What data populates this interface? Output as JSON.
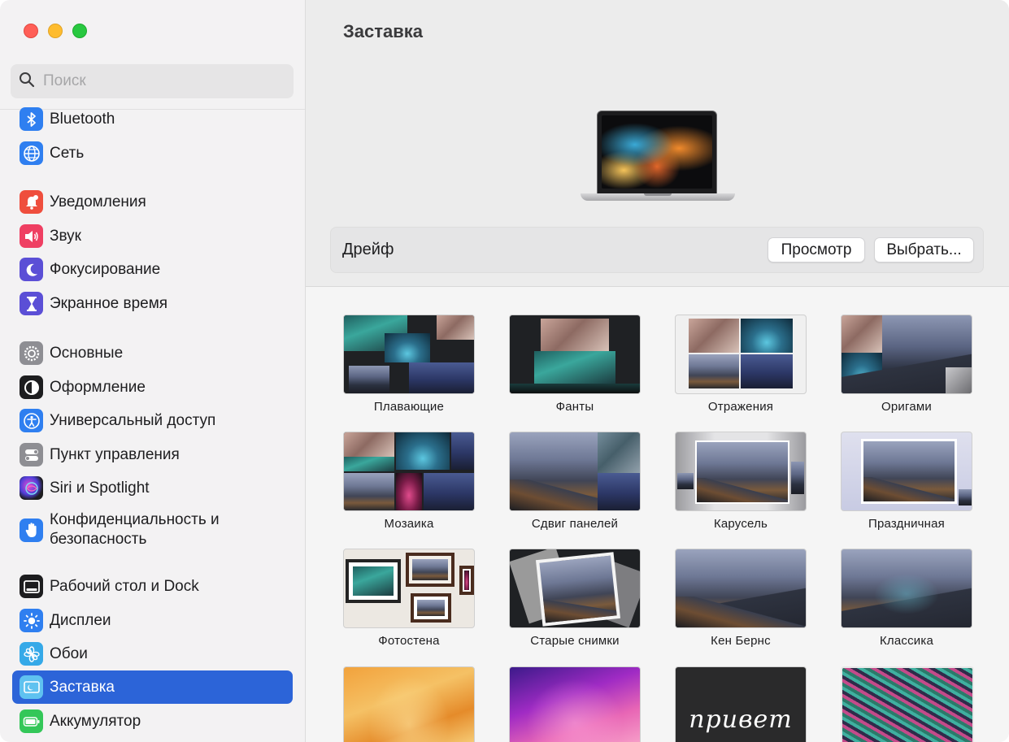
{
  "window": {
    "title": "Заставка"
  },
  "search": {
    "placeholder": "Поиск"
  },
  "sidebar": {
    "items": [
      {
        "label": "Bluetooth",
        "icon": "bluetooth-icon",
        "color": "#2f7ff0"
      },
      {
        "label": "Сеть",
        "icon": "globe-icon",
        "color": "#2f7ff0"
      },
      {
        "label": "Уведомления",
        "icon": "bell-icon",
        "color": "#ef4e3d"
      },
      {
        "label": "Звук",
        "icon": "speaker-icon",
        "color": "#ef3f62"
      },
      {
        "label": "Фокусирование",
        "icon": "moon-icon",
        "color": "#5b4fd6"
      },
      {
        "label": "Экранное время",
        "icon": "hourglass-icon",
        "color": "#5b4fd6"
      },
      {
        "label": "Основные",
        "icon": "gear-icon",
        "color": "#8e8e93"
      },
      {
        "label": "Оформление",
        "icon": "appearance-icon",
        "color": "#1d1d1f"
      },
      {
        "label": "Универсальный доступ",
        "icon": "accessibility-icon",
        "color": "#2f7ff0"
      },
      {
        "label": "Пункт управления",
        "icon": "toggles-icon",
        "color": "#8e8e93"
      },
      {
        "label": "Siri и Spotlight",
        "icon": "siri-icon",
        "color": "#1d1d1f"
      },
      {
        "label": "Конфиденциальность и безопасность",
        "icon": "hand-icon",
        "color": "#2f7ff0"
      },
      {
        "label": "Рабочий стол и Dock",
        "icon": "dock-icon",
        "color": "#1d1d1f"
      },
      {
        "label": "Дисплеи",
        "icon": "sun-icon",
        "color": "#2f7ff0"
      },
      {
        "label": "Обои",
        "icon": "flower-icon",
        "color": "#35a9e8"
      },
      {
        "label": "Заставка",
        "icon": "screensaver-icon",
        "color": "#5fc2f0",
        "selected": true
      },
      {
        "label": "Аккумулятор",
        "icon": "battery-icon",
        "color": "#34c759"
      }
    ]
  },
  "main": {
    "title": "Заставка",
    "current_saver": "Дрейф",
    "preview_label": "Просмотр",
    "choose_label": "Выбрать..."
  },
  "savers": [
    {
      "label": "Плавающие",
      "look": "floating"
    },
    {
      "label": "Фанты",
      "look": "flipup"
    },
    {
      "label": "Отражения",
      "look": "reflections"
    },
    {
      "label": "Оригами",
      "look": "origami"
    },
    {
      "label": "Мозаика",
      "look": "mosaic"
    },
    {
      "label": "Сдвиг панелей",
      "look": "sliding"
    },
    {
      "label": "Карусель",
      "look": "carousel"
    },
    {
      "label": "Праздничная",
      "look": "holiday"
    },
    {
      "label": "Фотостена",
      "look": "photowall"
    },
    {
      "label": "Старые снимки",
      "look": "vintage"
    },
    {
      "label": "Кен Бернс",
      "look": "kenburns"
    },
    {
      "label": "Классика",
      "look": "classic"
    },
    {
      "label": "",
      "look": "ventura"
    },
    {
      "label": "",
      "look": "monterey"
    },
    {
      "label": "привет",
      "look": "hello"
    },
    {
      "label": "",
      "look": "drift"
    }
  ]
}
